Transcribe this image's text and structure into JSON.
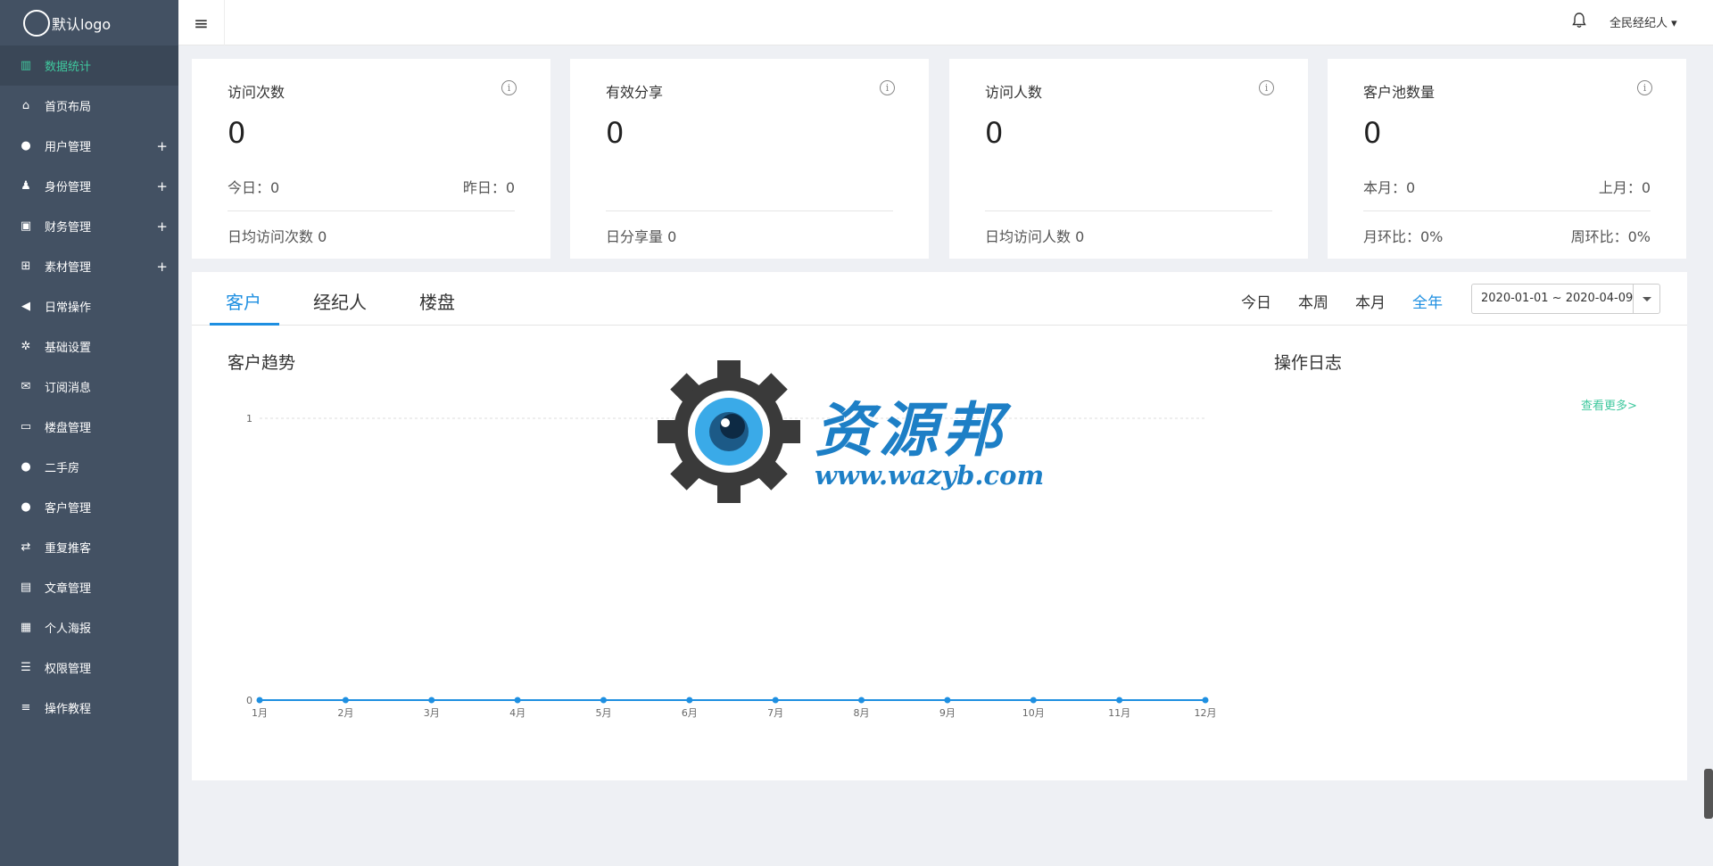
{
  "logo": {
    "text": "默认logo"
  },
  "sidebar": {
    "items": [
      {
        "label": "数据统计",
        "icon": "bar-chart-icon",
        "glyph": "▥",
        "has_plus": false,
        "active": true
      },
      {
        "label": "首页布局",
        "icon": "home-icon",
        "glyph": "⌂",
        "has_plus": false
      },
      {
        "label": "用户管理",
        "icon": "user-icon",
        "glyph": "●",
        "has_plus": true
      },
      {
        "label": "身份管理",
        "icon": "person-icon",
        "glyph": "♟",
        "has_plus": true
      },
      {
        "label": "财务管理",
        "icon": "money-icon",
        "glyph": "▣",
        "has_plus": true
      },
      {
        "label": "素材管理",
        "icon": "sitemap-icon",
        "glyph": "⊞",
        "has_plus": true
      },
      {
        "label": "日常操作",
        "icon": "bullhorn-icon",
        "glyph": "◀",
        "has_plus": false
      },
      {
        "label": "基础设置",
        "icon": "gears-icon",
        "glyph": "✲",
        "has_plus": false
      },
      {
        "label": "订阅消息",
        "icon": "envelope-icon",
        "glyph": "✉",
        "has_plus": false
      },
      {
        "label": "楼盘管理",
        "icon": "laptop-icon",
        "glyph": "▭",
        "has_plus": false
      },
      {
        "label": "二手房",
        "icon": "apple-icon",
        "glyph": "●",
        "has_plus": false
      },
      {
        "label": "客户管理",
        "icon": "customer-icon",
        "glyph": "●",
        "has_plus": false
      },
      {
        "label": "重复推客",
        "icon": "retweet-icon",
        "glyph": "⇄",
        "has_plus": false
      },
      {
        "label": "文章管理",
        "icon": "book-icon",
        "glyph": "▤",
        "has_plus": false
      },
      {
        "label": "个人海报",
        "icon": "qrcode-icon",
        "glyph": "▦",
        "has_plus": false
      },
      {
        "label": "权限管理",
        "icon": "list-indent-icon",
        "glyph": "☰",
        "has_plus": false
      },
      {
        "label": "操作教程",
        "icon": "list-icon",
        "glyph": "≡",
        "has_plus": false
      }
    ],
    "plus_glyph": "+"
  },
  "topbar": {
    "menu_glyph": "≡",
    "bell_glyph": "🔔",
    "user_label": "全民经纪人 ▾"
  },
  "cards": [
    {
      "title": "访问次数",
      "value": "0",
      "left": "今日：0",
      "right": "昨日：0",
      "bottom_left": "日均访问次数 0",
      "bottom_right": ""
    },
    {
      "title": "有效分享",
      "value": "0",
      "left": "",
      "right": "",
      "bottom_left": "日分享量 0",
      "bottom_right": ""
    },
    {
      "title": "访问人数",
      "value": "0",
      "left": "",
      "right": "",
      "bottom_left": "日均访问人数 0",
      "bottom_right": ""
    },
    {
      "title": "客户池数量",
      "value": "0",
      "left": "本月：0",
      "right": "上月：0",
      "bottom_left": "月环比：0%",
      "bottom_right": "周环比：0%"
    }
  ],
  "info_glyph": "i",
  "tabs": [
    {
      "label": "客户",
      "active": true
    },
    {
      "label": "经纪人",
      "active": false
    },
    {
      "label": "楼盘",
      "active": false
    }
  ],
  "ranges": [
    {
      "label": "今日",
      "active": false
    },
    {
      "label": "本周",
      "active": false
    },
    {
      "label": "本月",
      "active": false
    },
    {
      "label": "全年",
      "active": true
    }
  ],
  "date_range": "2020-01-01 ~ 2020-04-09",
  "sections": {
    "trend_title": "客户趋势",
    "log_title": "操作日志",
    "view_more": "查看更多>"
  },
  "watermark": {
    "brand": "资源邦",
    "url": "www.wazyb.com"
  },
  "chart_data": {
    "type": "line",
    "categories": [
      "1月",
      "2月",
      "3月",
      "4月",
      "5月",
      "6月",
      "7月",
      "8月",
      "9月",
      "10月",
      "11月",
      "12月"
    ],
    "values": [
      0,
      0,
      0,
      0,
      0,
      0,
      0,
      0,
      0,
      0,
      0,
      0
    ],
    "y_ticks": [
      0,
      1
    ],
    "ylim": [
      0,
      1
    ],
    "title": "",
    "xlabel": "",
    "ylabel": "",
    "grid": true,
    "color": "#1e8fe1"
  }
}
